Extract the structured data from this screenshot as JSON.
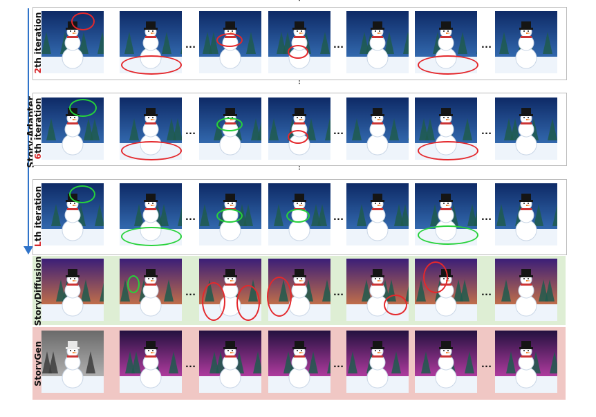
{
  "method_label": "Story-Adapter",
  "rows": [
    {
      "prefix": "2",
      "suffix": "th iteration"
    },
    {
      "prefix": "6",
      "suffix": "th iteration"
    },
    {
      "prefix": "L",
      "suffix": "th iteration"
    }
  ],
  "baselines": [
    "StoryDiffusion",
    "StoryGen"
  ],
  "ellipsis": "…",
  "vdots": "⋮",
  "colors": {
    "arrow": "#2f73c9",
    "highlight_text": "#d6262a",
    "marker_red": "#e4282c",
    "marker_green": "#27d23a",
    "storydiffusion_band": "#deeed4",
    "storygen_band": "#f0c7c4"
  }
}
